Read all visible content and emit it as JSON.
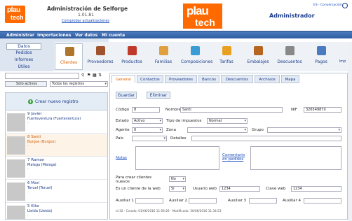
{
  "header": {
    "title": "Administración de Selforge",
    "version": "1.01.81",
    "check_updates": "Comprobar actualizaciones",
    "user": "Administrador",
    "lang": "ES · Conversación",
    "small_logo_top": "plau",
    "small_logo_bottom": "tech",
    "big_logo_top": "plau",
    "big_logo_bottom": "tech"
  },
  "menu": [
    "Administrar",
    "Importaciones",
    "Ver datos",
    "Mi cuenta"
  ],
  "sidebar_links": [
    "Datos",
    "Pedidos",
    "Informes",
    "Útiles"
  ],
  "modules": [
    {
      "label": "Clientes",
      "color": "#b0752c"
    },
    {
      "label": "Proveedores",
      "color": "#a0522d"
    },
    {
      "label": "Productos",
      "color": "#c0392b"
    },
    {
      "label": "Familias",
      "color": "#e0a040"
    },
    {
      "label": "Composiciones",
      "color": "#3a9bd5"
    },
    {
      "label": "Tarifas",
      "color": "#e8a020"
    },
    {
      "label": "Embalajes",
      "color": "#b5651d"
    },
    {
      "label": "Descuentos",
      "color": "#888888"
    },
    {
      "label": "Pagos",
      "color": "#4a7ac0"
    }
  ],
  "module_partial": "Imp",
  "filters": {
    "active": "Sólo activos",
    "all": "Todos los registros"
  },
  "list": {
    "new_record": "Crear nuevo registro",
    "records": [
      {
        "name": "9 Javier",
        "city": "Fuerteventura (Fuerteventura)",
        "extra": "-"
      },
      {
        "name": "8 Santi",
        "city": "Burgos (Burgos)",
        "extra": "-"
      },
      {
        "name": "7 Ramon",
        "city": "Malaga (Malaga)",
        "extra": "-"
      },
      {
        "name": "6 Mari",
        "city": "Teruel (Teruel)",
        "extra": "-"
      },
      {
        "name": "5 Kiko",
        "city": "Lleida (Lleida)",
        "extra": "-"
      }
    ]
  },
  "tabs": [
    "General",
    "Contactos",
    "Proveedores",
    "Bancos",
    "Descuentos",
    "Archivos",
    "Mapa"
  ],
  "buttons": {
    "save": "Guardar",
    "delete": "Eliminar"
  },
  "form": {
    "codigo_label": "Código",
    "codigo_value": "8",
    "nombre_label": "Nombre",
    "nombre_value": "Santi",
    "nif_label": "NIF",
    "nif_value": "32654987X",
    "estado_label": "Estado",
    "estado_value": "Activo",
    "tipo_label": "Tipo de impuestos",
    "tipo_value": "Normal",
    "agente_label": "Agente",
    "agente_value": "0",
    "zona_label": "Zona",
    "grupo_label": "Grupo",
    "pais_label": "País",
    "detalles_label": "Detalles",
    "notas_label": "Notas",
    "comentario_label": "Comentario en pedidos",
    "crear_clientes_label": "Para crear clientes nuevos",
    "crear_clientes_value": "No",
    "cliente_web_label": "Es un cliente de la web",
    "cliente_web_value": "Sí",
    "usuario_web_label": "Usuario web",
    "usuario_web_value": "1234",
    "clave_web_label": "Clave web",
    "clave_web_value": "1234",
    "aux1": "Auxiliar 1",
    "aux2": "Auxiliar 2",
    "aux3": "Auxiliar 3",
    "aux4": "Auxiliar 4",
    "footer": "id 32 - Creado: 01/06/2016 11:56:26 - Modificado: 30/06/2016 11:34:53"
  },
  "chart_data": {
    "type": "table",
    "title": "",
    "columns": [
      "name",
      "city"
    ],
    "rows": [
      [
        "9 Javier",
        "Fuerteventura (Fuerteventura)"
      ],
      [
        "8 Santi",
        "Burgos (Burgos)"
      ],
      [
        "7 Ramon",
        "Malaga (Malaga)"
      ],
      [
        "6 Mari",
        "Teruel (Teruel)"
      ],
      [
        "5 Kiko",
        "Lleida (Lleida)"
      ]
    ]
  }
}
